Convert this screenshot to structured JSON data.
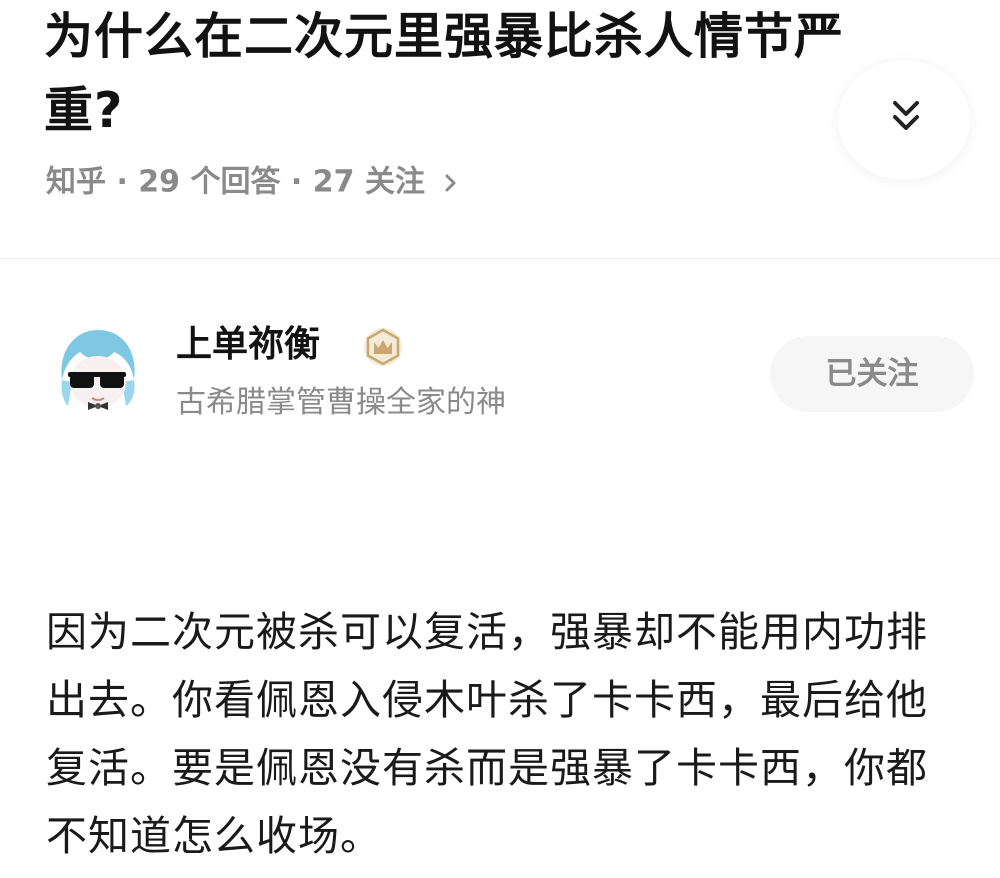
{
  "question": {
    "title": "为什么在二次元里强暴比杀人情节严重?",
    "meta": "知乎 · 29 个回答 · 27 关注"
  },
  "author": {
    "name": "上单祢衡",
    "bio": "古希腊掌管曹操全家的神",
    "follow_label": "已关注"
  },
  "answer": {
    "text": "因为二次元被杀可以复活，强暴却不能用内功排出去。你看佩恩入侵木叶杀了卡卡西，最后给他复活。要是佩恩没有杀而是强暴了卡卡西，你都不知道怎么收场。"
  },
  "icons": {
    "expand": "double-chevron-down-icon",
    "meta_arrow": "chevron-right-icon",
    "badge": "crown-badge-icon",
    "avatar": "anime-avatar-with-sunglasses"
  },
  "colors": {
    "title": "#121212",
    "secondary": "#8a8a8a",
    "badge": "#c8a870",
    "avatar_hair": "#7ec8e3"
  }
}
